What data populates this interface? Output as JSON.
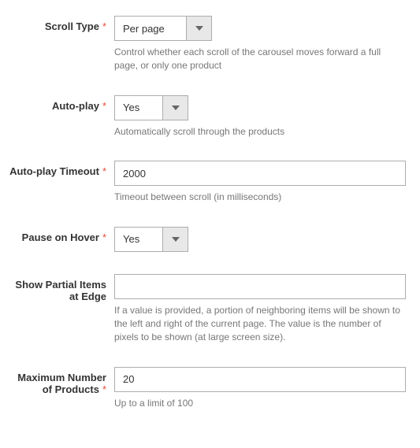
{
  "fields": {
    "scrollType": {
      "label": "Scroll Type",
      "required": true,
      "value": "Per page",
      "help": "Control whether each scroll of the carousel moves forward a full page, or only one product"
    },
    "autoplay": {
      "label": "Auto-play",
      "required": true,
      "value": "Yes",
      "help": "Automatically scroll through the products"
    },
    "autoplayTimeout": {
      "label": "Auto-play Timeout",
      "required": true,
      "value": "2000",
      "help": "Timeout between scroll (in milliseconds)"
    },
    "pauseOnHover": {
      "label": "Pause on Hover",
      "required": true,
      "value": "Yes",
      "help": ""
    },
    "showPartial": {
      "label": "Show Partial Items at Edge",
      "required": false,
      "value": "",
      "help": "If a value is provided, a portion of neighboring items will be shown to the left and right of the current page. The value is the number of pixels to be shown (at large screen size)."
    },
    "maxProducts": {
      "label": "Maximum Number of Products",
      "required": true,
      "value": "20",
      "help": "Up to a limit of 100"
    }
  },
  "requiredMark": "*"
}
